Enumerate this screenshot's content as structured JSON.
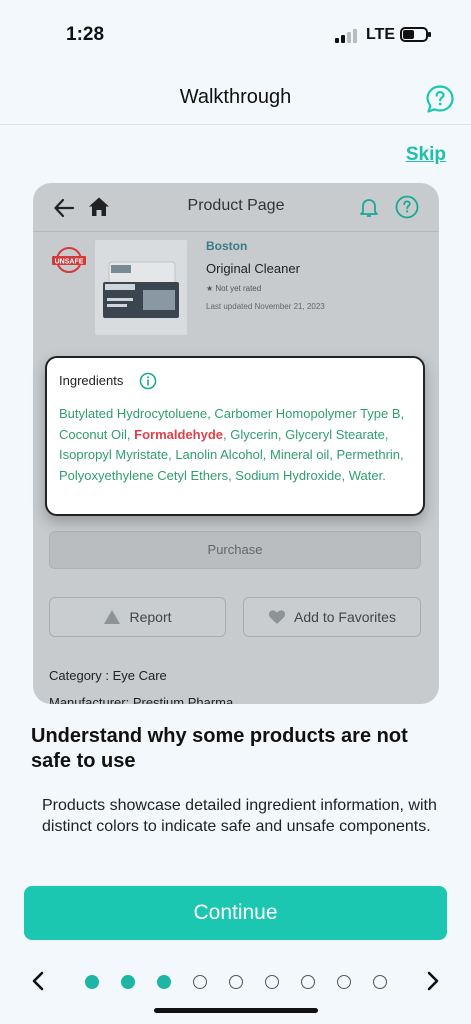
{
  "status_bar": {
    "time": "1:28",
    "network": "LTE"
  },
  "header": {
    "title": "Walkthrough"
  },
  "skip_label": "Skip",
  "preview": {
    "title": "Product Page",
    "stamp_text": "UNSAFE",
    "product": {
      "brand": "Boston",
      "name": "Original Cleaner",
      "rating": "Not yet rated",
      "updated": "Last updated November 21, 2023"
    },
    "purchase_label": "Purchase",
    "report_label": "Report",
    "favorites_label": "Add to Favorites",
    "category": "Category : Eye Care",
    "manufacturer": "Manufacturer: Prestium Pharma"
  },
  "ingredients": {
    "title": "Ingredients",
    "before": "Butylated Hydrocytoluene, Carbomer Homopolymer Type B, Coconut Oil, ",
    "unsafe": "Formaldehyde",
    "after": ", Glycerin, Glyceryl Stearate, Isopropyl Myristate, Lanolin Alcohol, Mineral oil, Permethrin, Polyoxyethylene Cetyl Ethers, Sodium Hydroxide, Water."
  },
  "heading": "Understand why some products are not safe to use",
  "description": "Products showcase detailed ingredient information, with distinct colors to indicate safe and unsafe components.",
  "continue_label": "Continue",
  "pager": {
    "total_pages": 9,
    "current_page": 3
  },
  "colors": {
    "accent": "#1cc7b1",
    "safe_ingredient": "#2f9e6f",
    "unsafe_ingredient": "#e0404a"
  },
  "icons": [
    "back-arrow-icon",
    "home-icon",
    "bell-icon",
    "help-icon",
    "info-icon",
    "warning-icon",
    "heart-icon",
    "chevron-left-icon",
    "chevron-right-icon"
  ]
}
